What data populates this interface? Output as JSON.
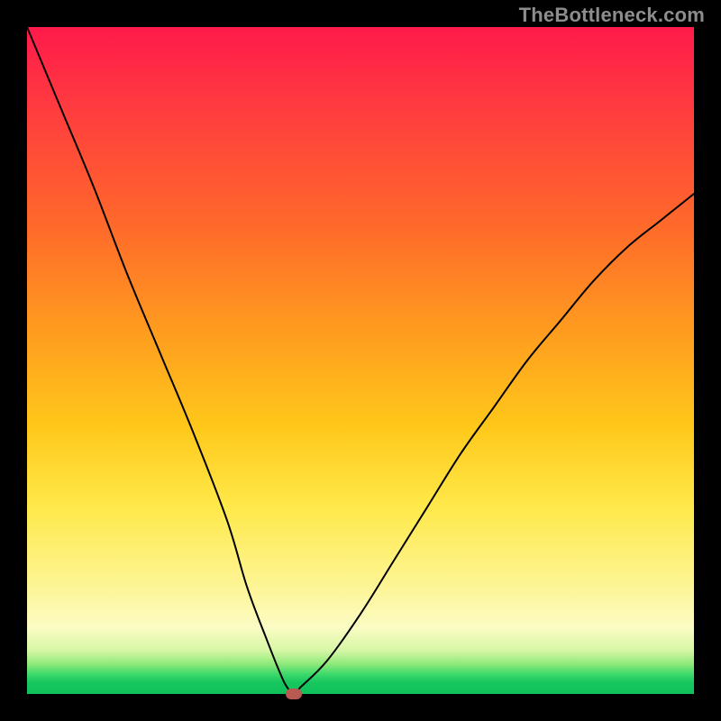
{
  "watermark": "TheBottleneck.com",
  "chart_data": {
    "type": "line",
    "title": "",
    "xlabel": "",
    "ylabel": "",
    "xlim": [
      0,
      100
    ],
    "ylim": [
      0,
      100
    ],
    "grid": false,
    "legend": false,
    "background_gradient": {
      "direction": "vertical",
      "stops": [
        {
          "pos": 0.0,
          "color": "#ff1a4b"
        },
        {
          "pos": 0.3,
          "color": "#ff6a2a"
        },
        {
          "pos": 0.6,
          "color": "#ffc81a"
        },
        {
          "pos": 0.85,
          "color": "#fbfcc4"
        },
        {
          "pos": 0.96,
          "color": "#3fd96c"
        },
        {
          "pos": 1.0,
          "color": "#0fbf59"
        }
      ]
    },
    "series": [
      {
        "name": "bottleneck-curve",
        "x": [
          0,
          5,
          10,
          15,
          20,
          25,
          30,
          33,
          36,
          38,
          39,
          40,
          41,
          45,
          50,
          55,
          60,
          65,
          70,
          75,
          80,
          85,
          90,
          95,
          100
        ],
        "y": [
          100,
          88,
          76,
          63,
          51,
          39,
          26,
          16,
          8,
          3,
          1,
          0,
          1,
          5,
          12,
          20,
          28,
          36,
          43,
          50,
          56,
          62,
          67,
          71,
          75
        ],
        "stroke": "#000000",
        "stroke_width": 2
      }
    ],
    "marker": {
      "x": 40,
      "y": 0,
      "color": "#b75a52",
      "shape": "rounded-rect"
    }
  }
}
